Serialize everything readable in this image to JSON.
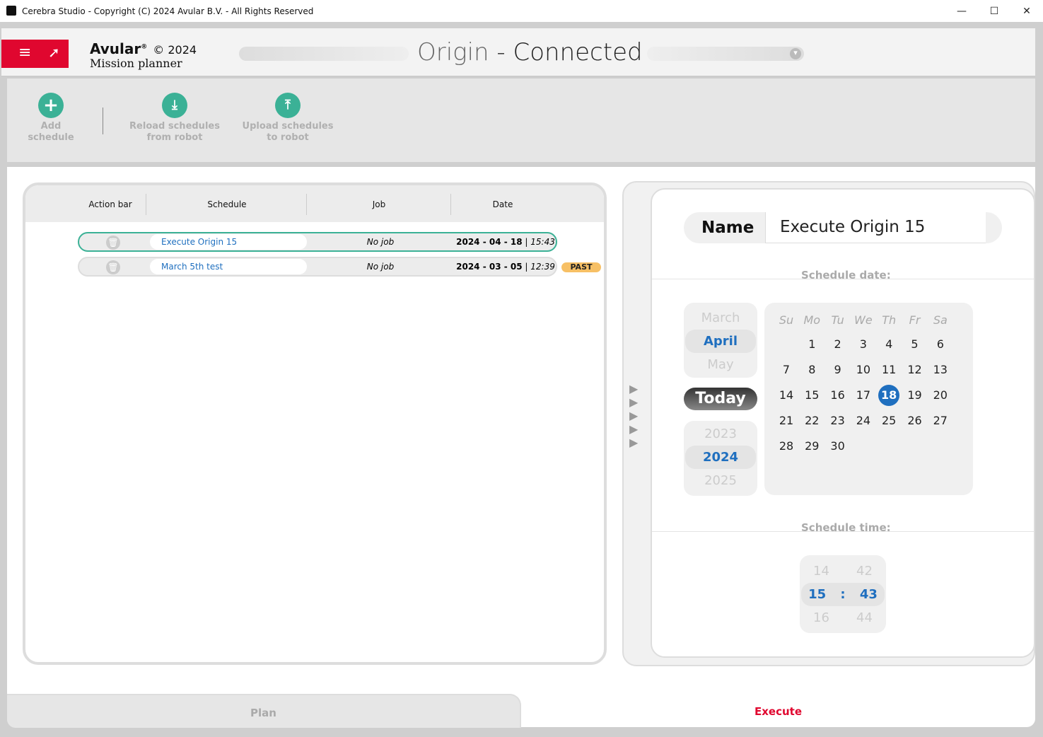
{
  "window": {
    "title": "Cerebra Studio - Copyright (C) 2024 Avular B.V. - All Rights Reserved"
  },
  "header": {
    "brand": "Avular",
    "reg": "®",
    "year": "© 2024",
    "subtitle": "Mission planner",
    "robot": "Origin",
    "status": "- Connected"
  },
  "toolbar": [
    {
      "icon": "plus-icon",
      "label1": "Add",
      "label2": "schedule"
    },
    {
      "icon": "download-icon",
      "label1": "Reload schedules",
      "label2": "from robot"
    },
    {
      "icon": "upload-icon",
      "label1": "Upload schedules",
      "label2": "to robot"
    }
  ],
  "table": {
    "headers": [
      "Action bar",
      "Schedule",
      "Job",
      "Date"
    ],
    "rows": [
      {
        "name": "Execute Origin 15",
        "job": "No job",
        "date": "2024 - 04 - 18",
        "time": "15:43",
        "selected": true,
        "badge": ""
      },
      {
        "name": "March 5th test",
        "job": "No job",
        "date": "2024 - 03 - 05",
        "time": "12:39",
        "selected": false,
        "badge": "PAST"
      }
    ]
  },
  "editor": {
    "name_label": "Name",
    "name_value": "Execute Origin 15",
    "date_label": "Schedule date:",
    "time_label": "Schedule time:",
    "today": "Today",
    "months": [
      "March",
      "April",
      "May"
    ],
    "years": [
      "2023",
      "2024",
      "2025"
    ],
    "weekdays": [
      "Su",
      "Mo",
      "Tu",
      "We",
      "Th",
      "Fr",
      "Sa"
    ],
    "first_weekday": 1,
    "days_in_month": 30,
    "selected_day": 18,
    "hours": [
      "14",
      "15",
      "16"
    ],
    "minutes": [
      "42",
      "43",
      "44"
    ],
    "colon": ":"
  },
  "tabs": {
    "plan": "Plan",
    "execute": "Execute"
  },
  "colors": {
    "accent": "#3bb196",
    "brand": "#e0072f",
    "selected": "#1f6fbf",
    "past": "#f7c065"
  }
}
